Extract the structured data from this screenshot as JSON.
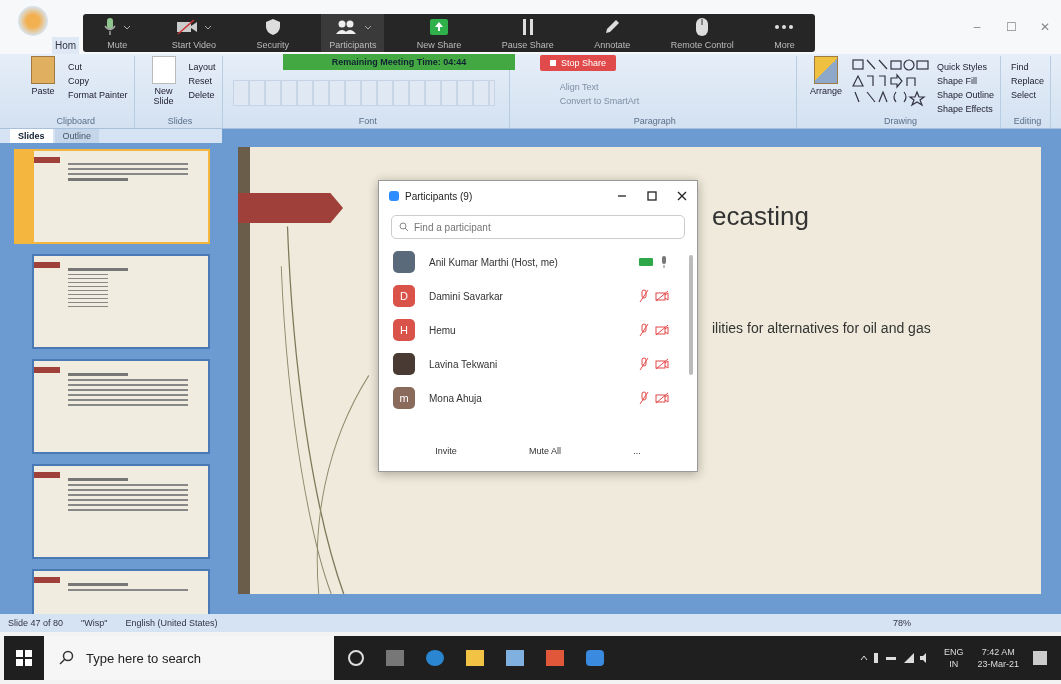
{
  "app_tab": "Hom",
  "window_controls": [
    "–",
    "☐",
    "✕"
  ],
  "zoom_toolbar": [
    {
      "label": "Mute",
      "kind": "mic",
      "caret": true
    },
    {
      "label": "Start Video",
      "kind": "video",
      "caret": true
    },
    {
      "label": "Security",
      "kind": "shield",
      "caret": false
    },
    {
      "label": "Participants",
      "kind": "people",
      "caret": true
    },
    {
      "label": "New Share",
      "kind": "share",
      "caret": false
    },
    {
      "label": "Pause Share",
      "kind": "pause",
      "caret": false
    },
    {
      "label": "Annotate",
      "kind": "pencil",
      "caret": false
    },
    {
      "label": "Remote Control",
      "kind": "mouse",
      "caret": false
    },
    {
      "label": "More",
      "kind": "more",
      "caret": false
    }
  ],
  "meeting_banner": {
    "text": "Remaining Meeting Time: 04:44",
    "stop_button": "Stop Share"
  },
  "ribbon": [
    {
      "label": "Clipboard",
      "kind": "clipboard",
      "large": "Paste",
      "buttons": [
        "Cut",
        "Copy",
        "Format Painter"
      ]
    },
    {
      "label": "Slides",
      "kind": "slides",
      "large": "New Slide",
      "buttons": [
        "Layout",
        "Reset",
        "Delete"
      ]
    },
    {
      "label": "Font",
      "kind": "font"
    },
    {
      "label": "Paragraph",
      "kind": "paragraph",
      "buttons": [
        "Align Text",
        "Convert to SmartArt"
      ]
    },
    {
      "label": "Drawing",
      "kind": "drawing",
      "large": "Arrange",
      "buttons": [
        "Quick Styles",
        "Shape Fill",
        "Shape Outline",
        "Shape Effects"
      ]
    },
    {
      "label": "Editing",
      "kind": "editing",
      "buttons": [
        "Find",
        "Replace",
        "Select"
      ]
    }
  ],
  "pane_tabs": [
    {
      "label": "Slides",
      "selected": true
    },
    {
      "label": "Outline",
      "selected": false
    }
  ],
  "thumbnails": [
    {
      "selected": true,
      "kind": "text"
    },
    {
      "selected": false,
      "kind": "list"
    },
    {
      "selected": false,
      "kind": "bullets"
    },
    {
      "selected": false,
      "kind": "bullets"
    },
    {
      "selected": false,
      "kind": "partial"
    }
  ],
  "slide": {
    "title": "ecasting",
    "body": "ilities for alternatives for oil and gas"
  },
  "participants": {
    "title": "Participants (9)",
    "search_placeholder": "Find a participant",
    "people": [
      {
        "name": "Anil Kumar Marthi (Host, me)",
        "kind": "photo",
        "color": "#5a6a7a",
        "muted": false,
        "video_on": true
      },
      {
        "name": "Damini Savarkar",
        "kind": "initial",
        "initial": "D",
        "color": "#d9534a",
        "muted": true,
        "video_on": false
      },
      {
        "name": "Hemu",
        "kind": "initial",
        "initial": "H",
        "color": "#d9534a",
        "muted": true,
        "video_on": false
      },
      {
        "name": "Lavina Tekwani",
        "kind": "photo",
        "color": "#4a3a34",
        "muted": true,
        "video_on": false
      },
      {
        "name": "Mona Ahuja",
        "kind": "initial",
        "initial": "m",
        "color": "#8a6a5a",
        "muted": true,
        "video_on": false
      }
    ],
    "buttons": [
      "Invite",
      "Mute All",
      "..."
    ]
  },
  "status_bar": {
    "slide": "Slide 47 of 80",
    "theme": "\"Wisp\"",
    "language": "English (United States)",
    "zoom": "78%"
  },
  "taskbar": {
    "search_placeholder": "Type here to search",
    "language": "ENG",
    "region": "IN",
    "time": "7:42 AM",
    "date": "23-Mar-21"
  }
}
